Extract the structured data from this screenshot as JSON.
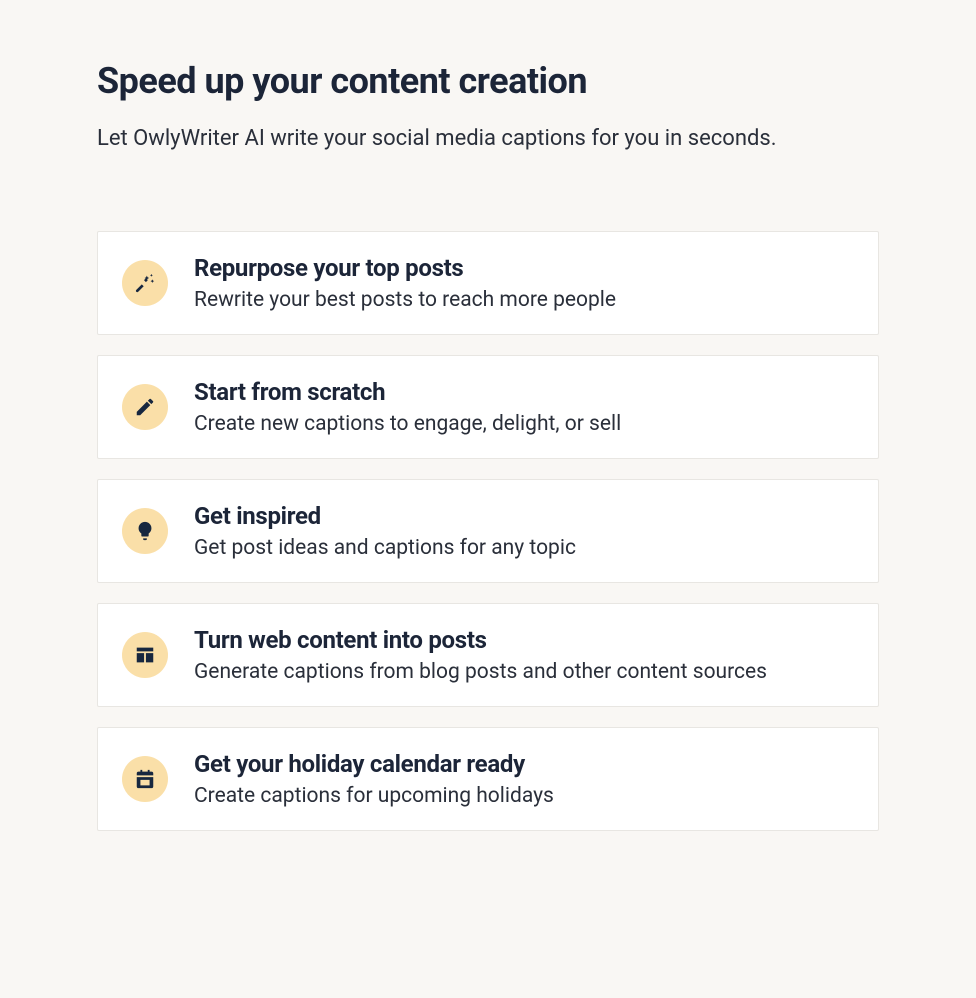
{
  "header": {
    "title": "Speed up your content creation",
    "subtitle": "Let OwlyWriter AI write your social media captions for you in seconds."
  },
  "options": [
    {
      "icon": "magic-wand-icon",
      "title": "Repurpose your top posts",
      "description": "Rewrite your best posts to reach more people"
    },
    {
      "icon": "pencil-icon",
      "title": "Start from scratch",
      "description": "Create new captions to engage, delight, or sell"
    },
    {
      "icon": "lightbulb-icon",
      "title": "Get inspired",
      "description": "Get post ideas and captions for any topic"
    },
    {
      "icon": "layout-icon",
      "title": "Turn web content into posts",
      "description": "Generate captions from blog posts and other content sources"
    },
    {
      "icon": "calendar-icon",
      "title": "Get your holiday calendar ready",
      "description": "Create captions for upcoming holidays"
    }
  ],
  "colors": {
    "background": "#f9f7f4",
    "text_dark": "#1c2538",
    "card_bg": "#ffffff",
    "card_border": "#e8e6e2",
    "icon_bg": "#fadfa8",
    "icon_fill": "#17273f"
  }
}
